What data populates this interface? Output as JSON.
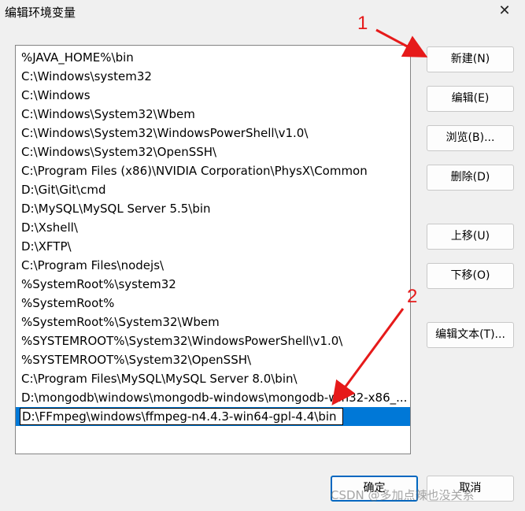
{
  "window": {
    "title": "编辑环境变量",
    "close": "✕"
  },
  "paths": [
    "%JAVA_HOME%\\bin",
    "C:\\Windows\\system32",
    "C:\\Windows",
    "C:\\Windows\\System32\\Wbem",
    "C:\\Windows\\System32\\WindowsPowerShell\\v1.0\\",
    "C:\\Windows\\System32\\OpenSSH\\",
    "C:\\Program Files (x86)\\NVIDIA Corporation\\PhysX\\Common",
    "D:\\Git\\Git\\cmd",
    "D:\\MySQL\\MySQL Server 5.5\\bin",
    "D:\\Xshell\\",
    "D:\\XFTP\\",
    "C:\\Program Files\\nodejs\\",
    "%SystemRoot%\\system32",
    "%SystemRoot%",
    "%SystemRoot%\\System32\\Wbem",
    "%SYSTEMROOT%\\System32\\WindowsPowerShell\\v1.0\\",
    "%SYSTEMROOT%\\System32\\OpenSSH\\",
    "C:\\Program Files\\MySQL\\MySQL Server 8.0\\bin\\",
    "D:\\mongodb\\windows\\mongodb-windows\\mongodb-win32-x86_..."
  ],
  "editing_value": "D:\\FFmpeg\\windows\\ffmpeg-n4.4.3-win64-gpl-4.4\\bin",
  "buttons": {
    "new": "新建(N)",
    "edit": "编辑(E)",
    "browse": "浏览(B)...",
    "delete": "删除(D)",
    "move_up": "上移(U)",
    "move_down": "下移(O)",
    "edit_text": "编辑文本(T)...",
    "ok": "确定",
    "cancel": "取消"
  },
  "annotations": {
    "label_1": "1",
    "label_2": "2",
    "color": "#e61a1a"
  },
  "watermark": "CSDN @多加点辣也没关系"
}
